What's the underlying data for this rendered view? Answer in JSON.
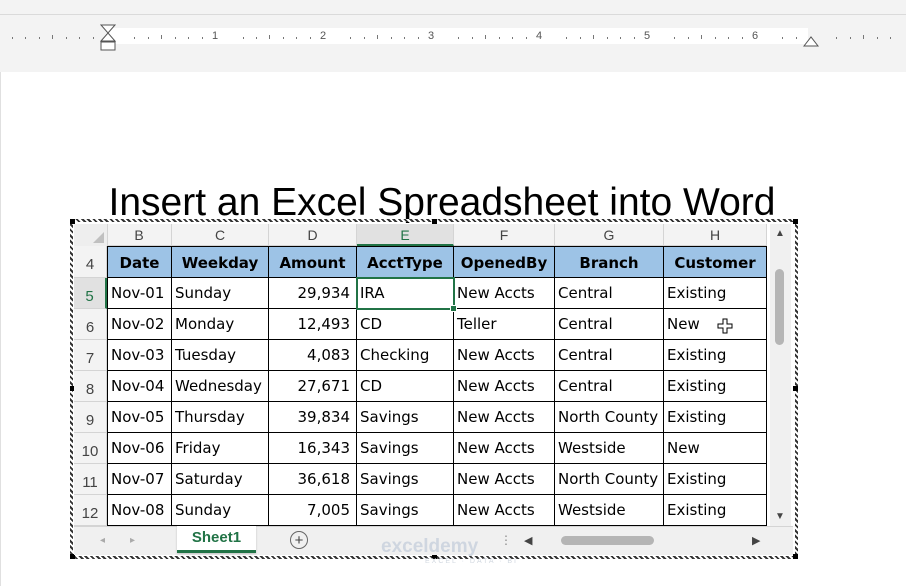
{
  "ruler": {
    "numbers": [
      "1",
      "2",
      "3",
      "4",
      "5",
      "6"
    ]
  },
  "document": {
    "title": "Insert an Excel Spreadsheet into Word"
  },
  "spreadsheet": {
    "column_headers": [
      "B",
      "C",
      "D",
      "E",
      "F",
      "G",
      "H"
    ],
    "active_column": "E",
    "row_numbers": [
      "4",
      "5",
      "6",
      "7",
      "8",
      "9",
      "10",
      "11",
      "12"
    ],
    "active_row": "5",
    "table_headers": [
      "Date",
      "Weekday",
      "Amount",
      "AcctType",
      "OpenedBy",
      "Branch",
      "Customer"
    ],
    "rows": [
      [
        "Nov-01",
        "Sunday",
        "29,934",
        "IRA",
        "New Accts",
        "Central",
        "Existing"
      ],
      [
        "Nov-02",
        "Monday",
        "12,493",
        "CD",
        "Teller",
        "Central",
        "New"
      ],
      [
        "Nov-03",
        "Tuesday",
        "4,083",
        "Checking",
        "New Accts",
        "Central",
        "Existing"
      ],
      [
        "Nov-04",
        "Wednesday",
        "27,671",
        "CD",
        "New Accts",
        "Central",
        "Existing"
      ],
      [
        "Nov-05",
        "Thursday",
        "39,834",
        "Savings",
        "New Accts",
        "North County",
        "Existing"
      ],
      [
        "Nov-06",
        "Friday",
        "16,343",
        "Savings",
        "New Accts",
        "Westside",
        "New"
      ],
      [
        "Nov-07",
        "Saturday",
        "36,618",
        "Savings",
        "New Accts",
        "North County",
        "Existing"
      ],
      [
        "Nov-08",
        "Sunday",
        "7,005",
        "Savings",
        "New Accts",
        "Westside",
        "Existing"
      ]
    ],
    "sheet_tab": "Sheet1",
    "header_fill": "#9dc3e6",
    "accent": "#217346"
  },
  "watermark": {
    "name": "exceldemy",
    "tagline": "EXCEL · DATA · BI"
  }
}
